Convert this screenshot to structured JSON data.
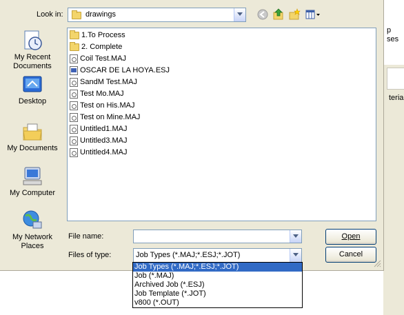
{
  "look_in": {
    "label": "Look in:",
    "value": "drawings"
  },
  "places": [
    {
      "label": "My Recent Documents",
      "icon": "recent-documents-icon"
    },
    {
      "label": "Desktop",
      "icon": "desktop-icon"
    },
    {
      "label": "My Documents",
      "icon": "my-documents-icon"
    },
    {
      "label": "My Computer",
      "icon": "my-computer-icon"
    },
    {
      "label": "My Network Places",
      "icon": "network-places-icon"
    }
  ],
  "files": [
    {
      "name": "1.To Process",
      "type": "folder"
    },
    {
      "name": "2. Complete",
      "type": "folder"
    },
    {
      "name": "Coil Test.MAJ",
      "type": "maj"
    },
    {
      "name": "OSCAR DE LA HOYA.ESJ",
      "type": "esj"
    },
    {
      "name": "SandM Test.MAJ",
      "type": "maj"
    },
    {
      "name": "Test Mo.MAJ",
      "type": "maj"
    },
    {
      "name": "Test on His.MAJ",
      "type": "maj"
    },
    {
      "name": "Test on Mine.MAJ",
      "type": "maj"
    },
    {
      "name": "Untitled1.MAJ",
      "type": "maj"
    },
    {
      "name": "Untitled3.MAJ",
      "type": "maj"
    },
    {
      "name": "Untitled4.MAJ",
      "type": "maj"
    }
  ],
  "file_name": {
    "label": "File name:",
    "value": ""
  },
  "files_of_type": {
    "label": "Files of type:",
    "value": "Job Types (*.MAJ;*.ESJ;*.JOT)",
    "options": [
      "Job Types (*.MAJ;*.ESJ;*.JOT)",
      "Job (*.MAJ)",
      "Archived Job (*.ESJ)",
      "Job Template (*.JOT)",
      "v800 (*.OUT)"
    ],
    "selected_index": 0
  },
  "buttons": {
    "open": "Open",
    "cancel": "Cancel"
  },
  "background": {
    "fragment1": "p\nses",
    "fragment2": "teria"
  },
  "colors": {
    "dialog_bg": "#ece9d8",
    "selection": "#316ac5",
    "border": "#7f9db9"
  }
}
